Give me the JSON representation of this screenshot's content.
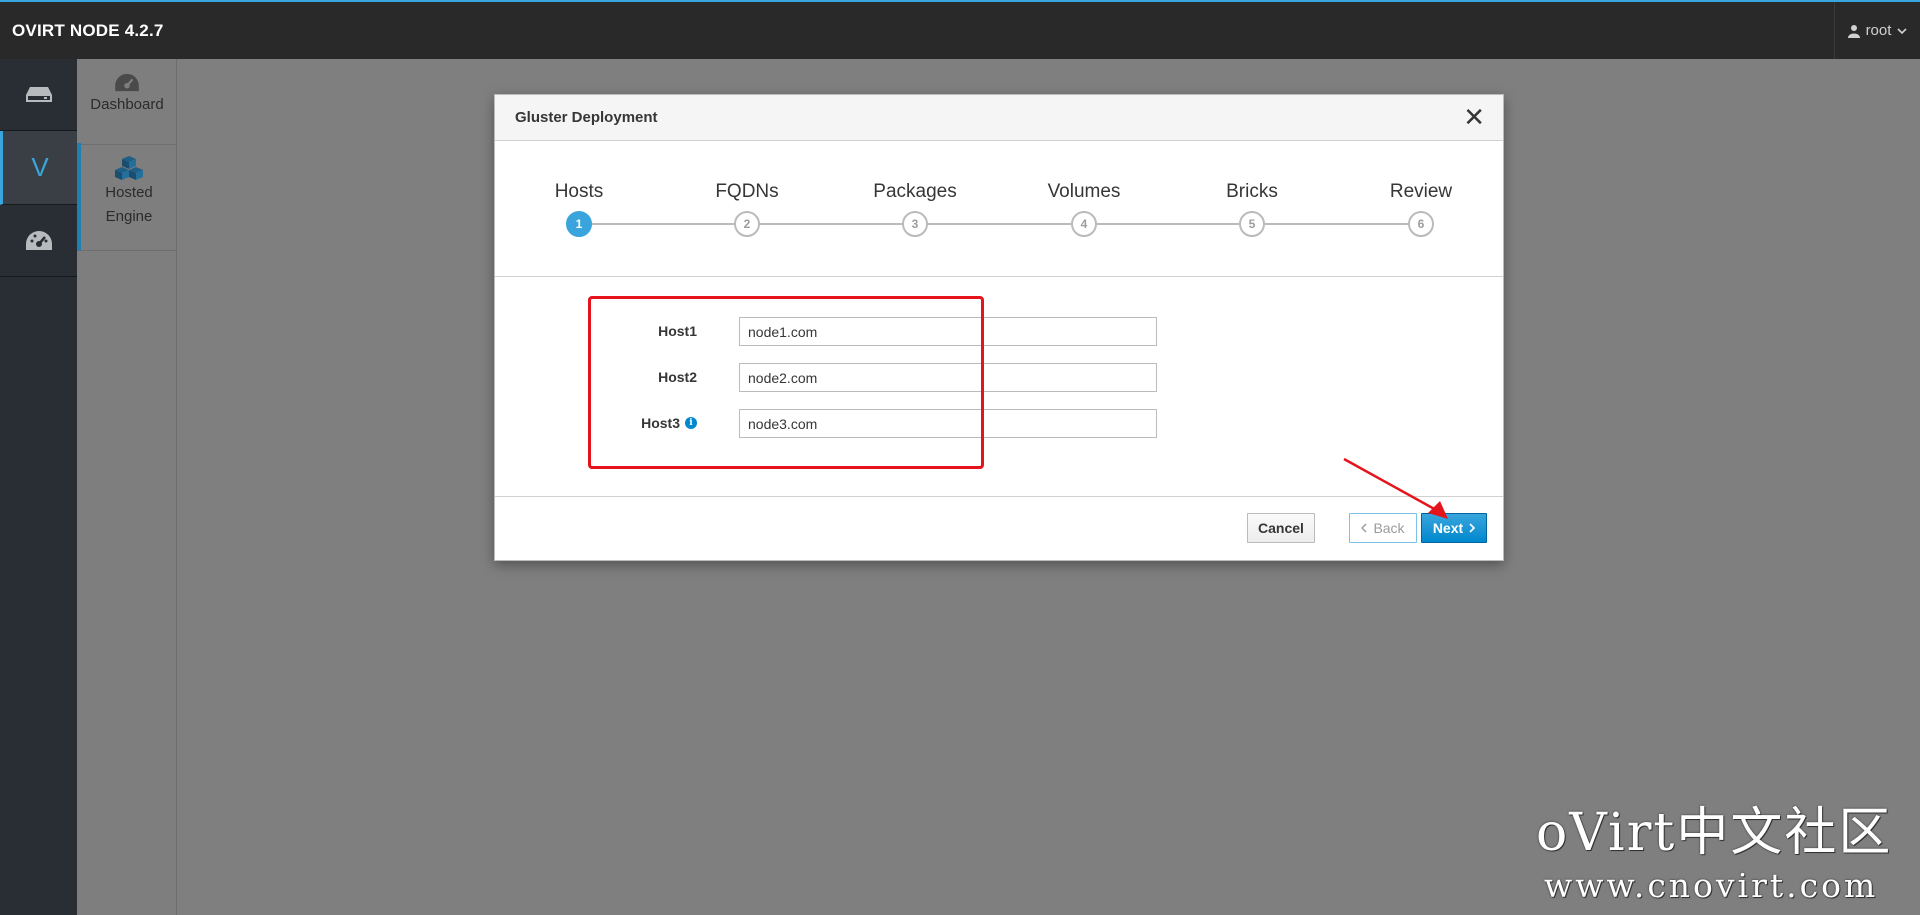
{
  "app": {
    "brand": "OVIRT NODE 4.2.7",
    "user": "root"
  },
  "rail": {
    "items": [
      {
        "icon": "server-icon"
      },
      {
        "icon": "virtualization-icon",
        "letter": "V",
        "active": true
      },
      {
        "icon": "dashboard-icon"
      }
    ]
  },
  "subnav": {
    "items": [
      {
        "label": "Dashboard",
        "icon": "dashboard-icon"
      },
      {
        "label": "Hosted Engine",
        "label_line1": "Hosted",
        "label_line2": "Engine",
        "icon": "cubes-icon",
        "active": true
      }
    ]
  },
  "modal": {
    "title": "Gluster Deployment",
    "close_glyph": "✕",
    "steps": [
      {
        "label": "Hosts",
        "number": "1",
        "active": true
      },
      {
        "label": "FQDNs",
        "number": "2"
      },
      {
        "label": "Packages",
        "number": "3"
      },
      {
        "label": "Volumes",
        "number": "4"
      },
      {
        "label": "Bricks",
        "number": "5"
      },
      {
        "label": "Review",
        "number": "6"
      }
    ],
    "fields": [
      {
        "label": "Host1",
        "value": "node1.com"
      },
      {
        "label": "Host2",
        "value": "node2.com"
      },
      {
        "label": "Host3",
        "value": "node3.com",
        "info": "i"
      }
    ],
    "buttons": {
      "cancel": "Cancel",
      "back": "Back",
      "next": "Next"
    }
  },
  "watermark": {
    "title": "oVirt中文社区",
    "url": "www.cnovirt.com"
  },
  "colors": {
    "accent": "#39a5dc",
    "primary": "#0088ce",
    "highlight": "#e5141c",
    "topbar": "#292929"
  }
}
